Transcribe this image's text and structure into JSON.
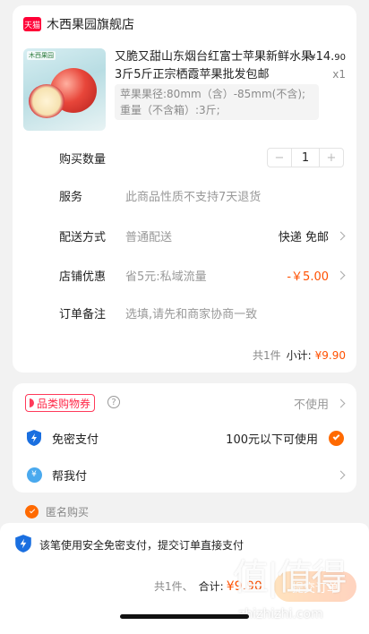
{
  "shop": {
    "badge": "天猫",
    "name": "木西果园旗舰店"
  },
  "product": {
    "brand_mark": "木西果园",
    "title": "又脆又甜山东烟台红富士苹果新鲜水果3斤5斤正宗栖霞苹果批发包邮",
    "price_symbol": "¥",
    "price_int": "14.",
    "price_dec": "90",
    "quantity_label": "x1",
    "sku_line1": "苹果果径:80mm（含）-85mm(不含);",
    "sku_line2": "重量（不含箱）:3斤;"
  },
  "order_rows": {
    "quantity": {
      "label": "购买数量",
      "value": "1",
      "minus": "−",
      "plus": "+"
    },
    "service": {
      "label": "服务",
      "value": "此商品性质不支持7天退货"
    },
    "delivery": {
      "label": "配送方式",
      "value": "普通配送",
      "right": "快递 免邮"
    },
    "shop_discount": {
      "label": "店铺优惠",
      "value": "省5元:私域流量",
      "right": "-￥5.00"
    },
    "remark": {
      "label": "订单备注",
      "placeholder": "选填,请先和商家协商一致"
    }
  },
  "subtotal": {
    "count": "共1件",
    "label": "小计:",
    "value": "¥9.90"
  },
  "payment": {
    "coupon_label": "品类购物券",
    "coupon_help": "?",
    "coupon_value": "不使用",
    "password_free_label": "免密支付",
    "password_free_value": "100元以下可使用",
    "help_pay_label": "帮我付",
    "help_pay_icon_text": "¥"
  },
  "anonymous": {
    "label": "匿名购买"
  },
  "bottom_bar": {
    "notice": "该笔使用安全免密支付，提交订单直接支付",
    "count": "共1件、",
    "total_label": "合计:",
    "total_value": "¥9.90",
    "submit_label": "提交订单"
  },
  "watermark": {
    "logo": "值|值得",
    "url": "zhizhizhi.com"
  },
  "colors": {
    "accent": "#ff5000",
    "tmall_red": "#ff0036",
    "shield_blue": "#1a6fe0",
    "help_pay_blue": "#4aa9ee"
  }
}
